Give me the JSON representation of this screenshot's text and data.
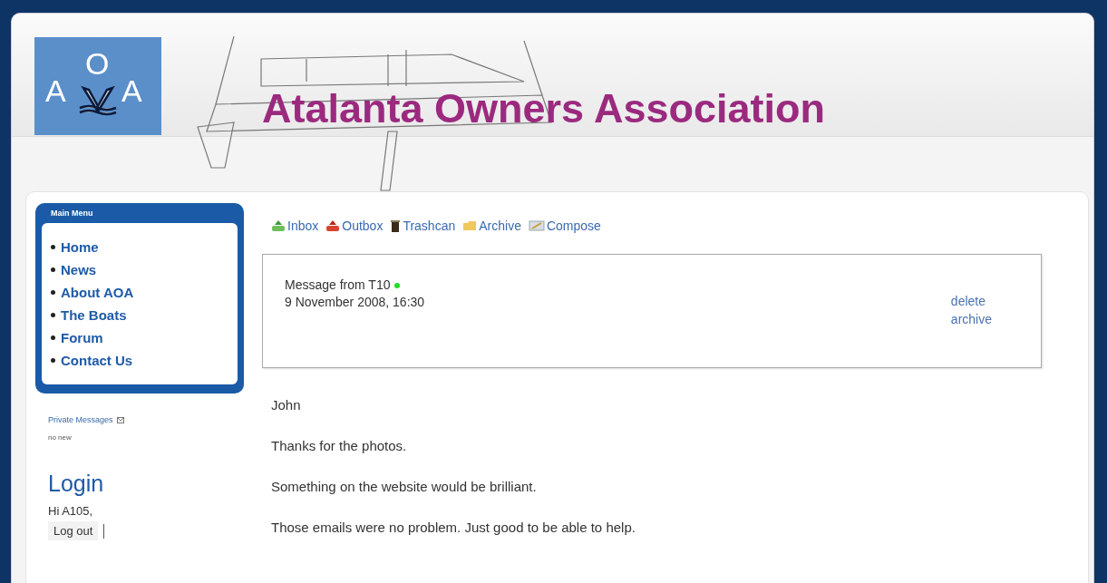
{
  "header": {
    "title": "Atalanta Owners Association",
    "logo": {
      "letters": [
        "A",
        "O",
        "A"
      ]
    }
  },
  "main_menu": {
    "title": "Main Menu",
    "items": [
      {
        "label": "Home"
      },
      {
        "label": "News"
      },
      {
        "label": "About AOA"
      },
      {
        "label": "The Boats"
      },
      {
        "label": "Forum"
      },
      {
        "label": "Contact Us"
      }
    ]
  },
  "private_messages": {
    "label": "Private Messages",
    "status": "no new"
  },
  "login": {
    "title": "Login",
    "greeting": "Hi A105,",
    "button": "Log out"
  },
  "toolbar": [
    {
      "kind": "inbox",
      "label": "Inbox"
    },
    {
      "kind": "outbox",
      "label": "Outbox"
    },
    {
      "kind": "trash",
      "label": "Trashcan"
    },
    {
      "kind": "archive",
      "label": "Archive"
    },
    {
      "kind": "compose",
      "label": "Compose"
    }
  ],
  "message": {
    "from": "Message from T10",
    "online": true,
    "date": "9 November 2008, 16:30",
    "actions": [
      "delete",
      "archive"
    ],
    "body": [
      "John",
      "Thanks for the photos.",
      "Something on the website would be brilliant.",
      "Those emails were no problem. Just good to be able to help."
    ]
  }
}
